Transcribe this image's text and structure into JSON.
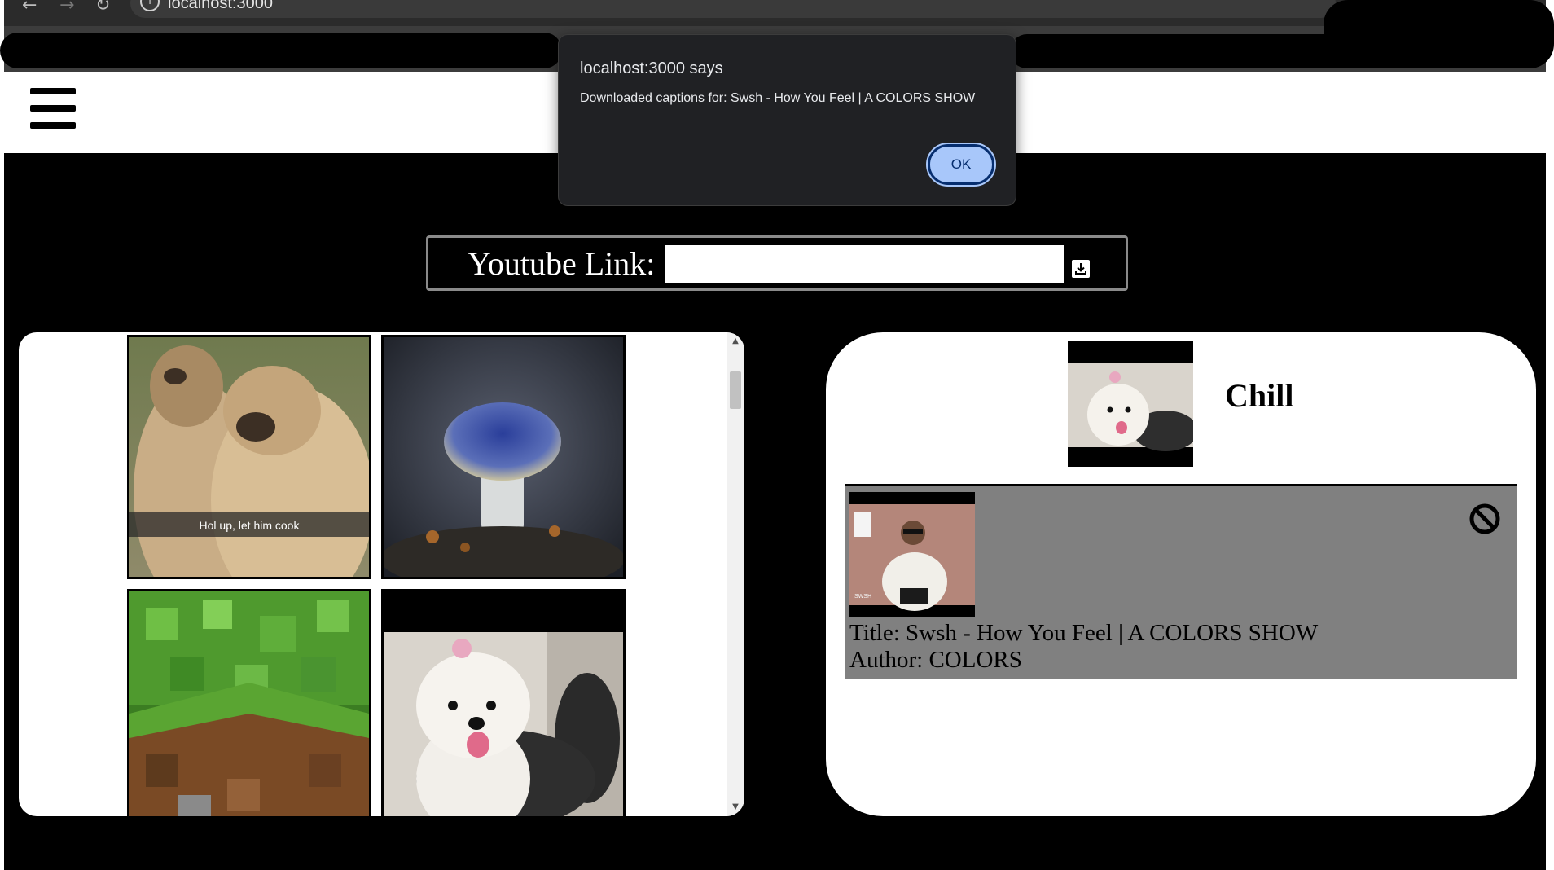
{
  "browser": {
    "url": "localhost:3000",
    "back_icon": "arrow-left-icon",
    "forward_icon": "arrow-right-icon",
    "reload_icon": "reload-icon",
    "site_info_icon": "info-icon"
  },
  "header": {
    "menu_icon": "hamburger-icon"
  },
  "youtube": {
    "label": "Youtube Link:",
    "input_value": "",
    "download_icon": "download-icon"
  },
  "gallery": {
    "images": [
      {
        "caption": "Hol up, let him cook",
        "subject": "marmots"
      },
      {
        "caption": "",
        "subject": "blue mushroom"
      },
      {
        "caption": "",
        "subject": "minecraft grass block"
      },
      {
        "caption": "",
        "subject": "white poodle"
      }
    ]
  },
  "playlist": {
    "name": "Chill",
    "songs": [
      {
        "title": "Title: Swsh - How You Feel | A COLORS SHOW",
        "author": "Author: COLORS",
        "thumb_text": "SWSH",
        "remove_icon": "block-icon"
      }
    ]
  },
  "dialog": {
    "title": "localhost:3000 says",
    "message": "Downloaded captions for: Swsh - How You Feel | A COLORS SHOW",
    "ok_label": "OK"
  },
  "colors": {
    "stage_bg": "#000000",
    "song_row_bg": "#808080",
    "dialog_bg": "#202124",
    "ok_button": "#a8c7fa"
  }
}
